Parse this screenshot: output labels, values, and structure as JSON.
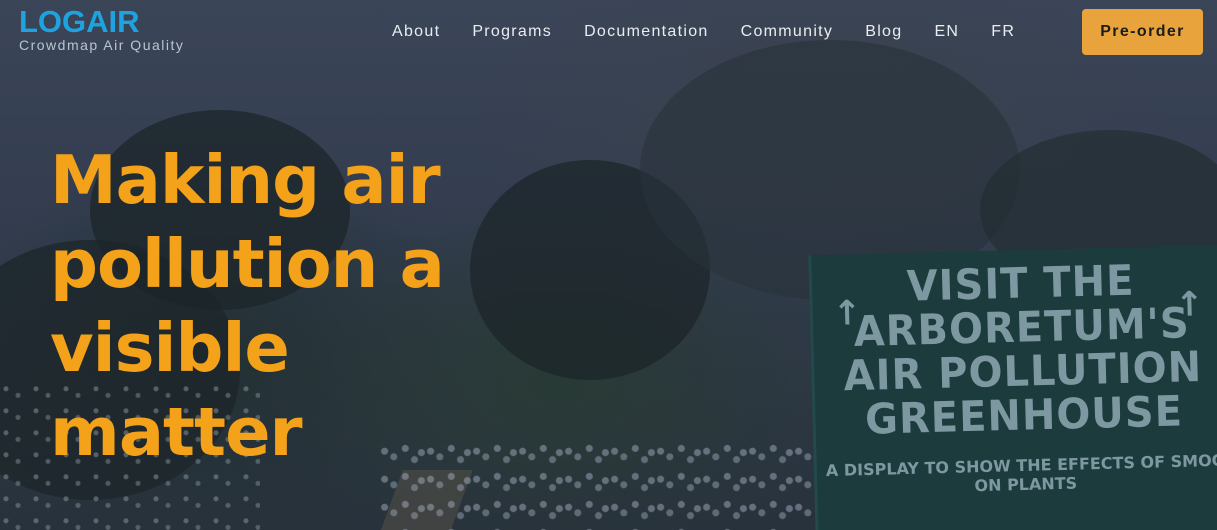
{
  "brand": {
    "name": "LOGAIR",
    "tagline": "Crowdmap Air Quality"
  },
  "nav": {
    "items": [
      {
        "label": "About"
      },
      {
        "label": "Programs"
      },
      {
        "label": "Documentation"
      },
      {
        "label": "Community"
      },
      {
        "label": "Blog"
      },
      {
        "label": "EN"
      },
      {
        "label": "FR"
      }
    ],
    "cta_label": "Pre-order"
  },
  "hero": {
    "headline": "Making air pollution a visible matter",
    "sign": {
      "lines": [
        "VISIT THE",
        "ARBORETUM'S",
        "AIR POLLUTION",
        "GREENHOUSE"
      ],
      "small": "A DISPLAY TO SHOW THE EFFECTS OF SMOG ON PLANTS"
    }
  },
  "colors": {
    "brand_blue": "#1fa3e0",
    "accent_orange": "#f3a21a",
    "cta_bg": "#e9a33c"
  }
}
